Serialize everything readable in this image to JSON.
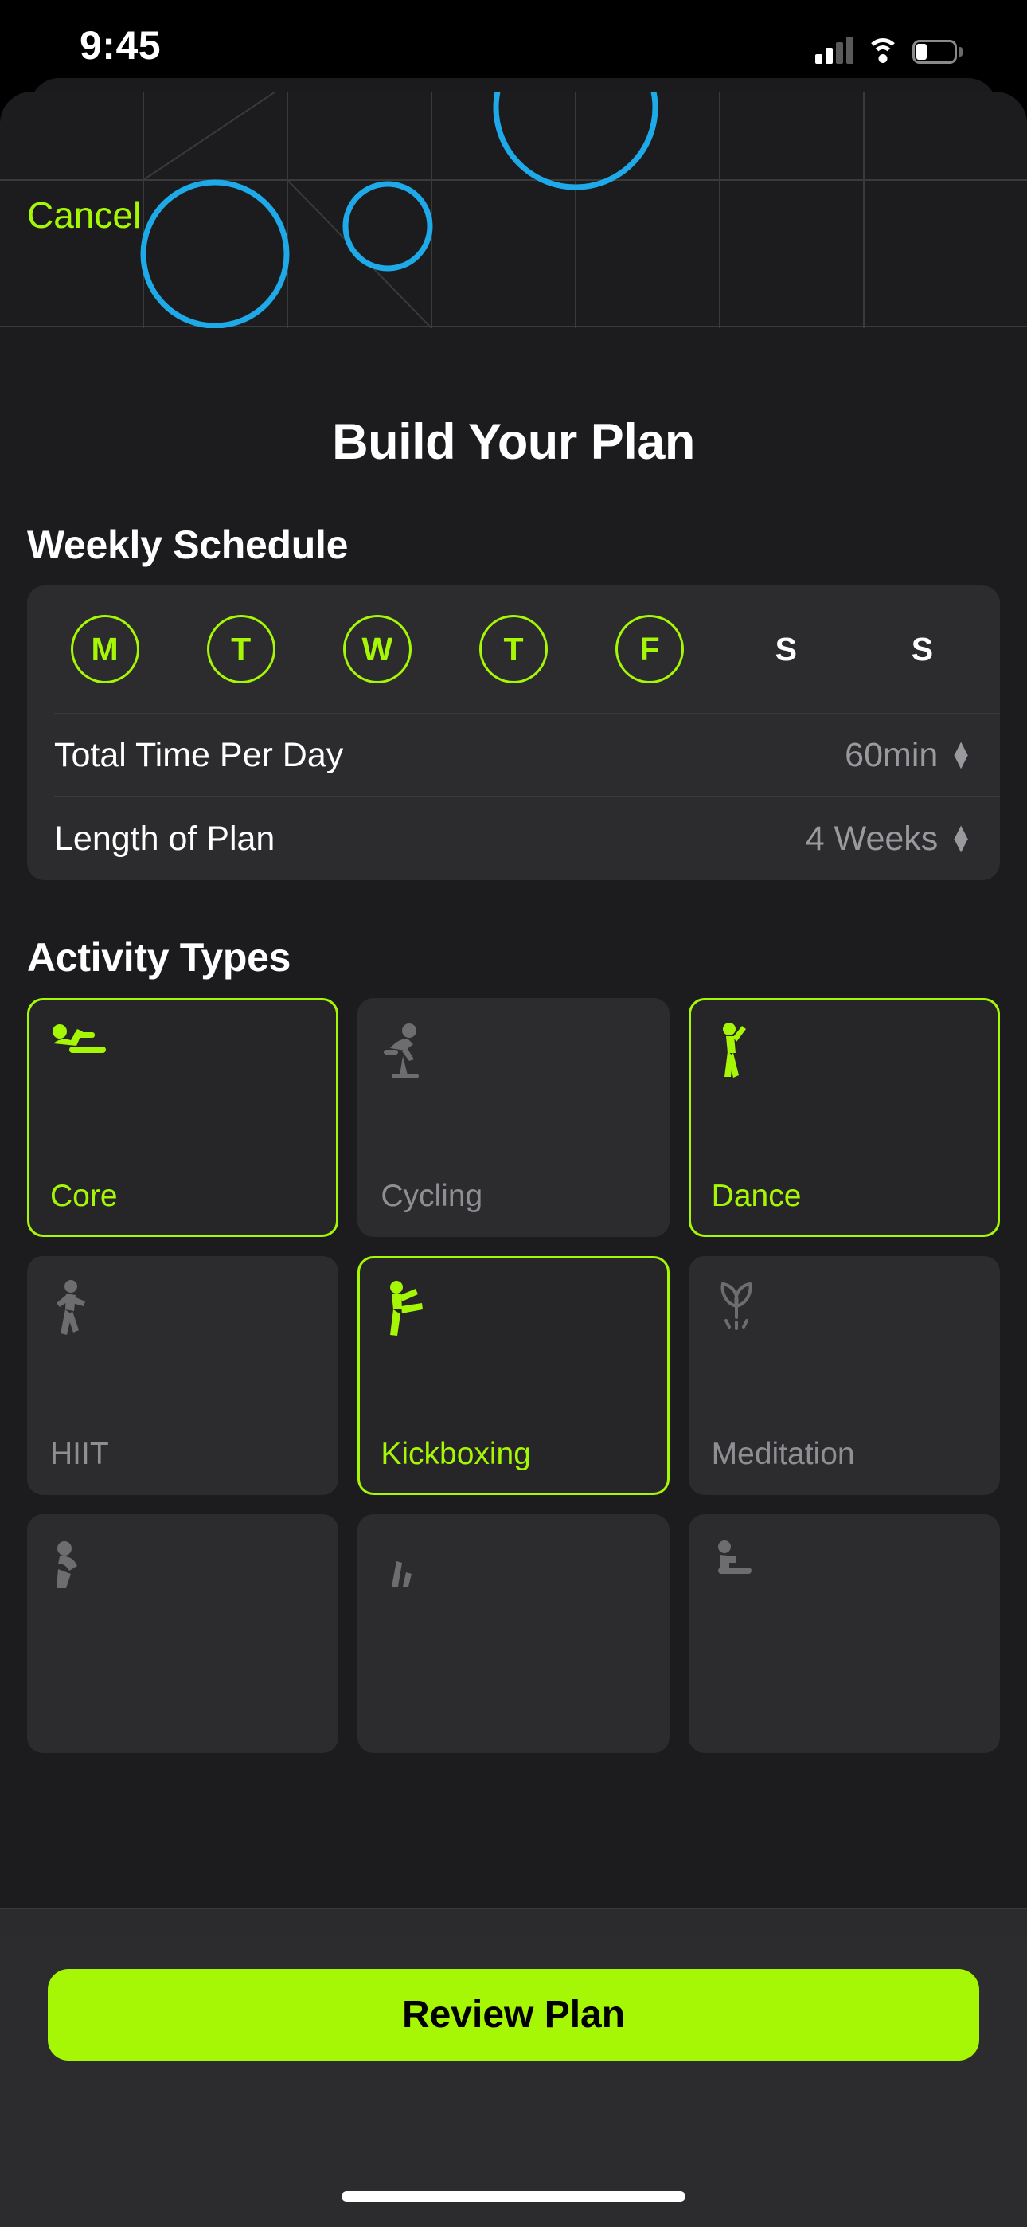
{
  "status_bar": {
    "time": "9:45",
    "cellular_icon": "cellular-signal-icon",
    "wifi_icon": "wifi-icon",
    "battery_icon": "battery-low-icon"
  },
  "header": {
    "cancel_label": "Cancel",
    "title": "Build Your Plan"
  },
  "decor": {
    "grid_line_color": "#3a3a3c",
    "circle_color": "#1ea9e8"
  },
  "weekly_schedule": {
    "section_title": "Weekly Schedule",
    "days": [
      {
        "label": "M",
        "selected": true
      },
      {
        "label": "T",
        "selected": true
      },
      {
        "label": "W",
        "selected": true
      },
      {
        "label": "T",
        "selected": true
      },
      {
        "label": "F",
        "selected": true
      },
      {
        "label": "S",
        "selected": false
      },
      {
        "label": "S",
        "selected": false
      }
    ],
    "rows": [
      {
        "label": "Total Time Per Day",
        "value": "60min",
        "stepper_icon": "chevron-up-down-icon"
      },
      {
        "label": "Length of Plan",
        "value": "4 Weeks",
        "stepper_icon": "chevron-up-down-icon"
      }
    ]
  },
  "activity_types": {
    "section_title": "Activity Types",
    "tiles": [
      {
        "label": "Core",
        "icon": "core-situp-icon",
        "selected": true
      },
      {
        "label": "Cycling",
        "icon": "cycling-bike-icon",
        "selected": false
      },
      {
        "label": "Dance",
        "icon": "dance-figure-icon",
        "selected": true
      },
      {
        "label": "HIIT",
        "icon": "hiit-runner-icon",
        "selected": false
      },
      {
        "label": "Kickboxing",
        "icon": "kickboxing-icon",
        "selected": true
      },
      {
        "label": "Meditation",
        "icon": "meditation-leaf-icon",
        "selected": false
      }
    ],
    "partial_row": [
      {
        "label": "",
        "icon": "yoga-pose-icon",
        "selected": false
      },
      {
        "label": "",
        "icon": "strength-icon",
        "selected": false
      },
      {
        "label": "",
        "icon": "stretching-icon",
        "selected": false
      }
    ]
  },
  "footer": {
    "review_label": "Review Plan",
    "home_indicator": "home-indicator"
  },
  "colors": {
    "accent_lime": "#a5f705",
    "sheet_bg": "#1c1c1e",
    "card_bg": "#2c2c2e",
    "muted_text": "#8e8e93",
    "decor_blue": "#1ea9e8"
  }
}
